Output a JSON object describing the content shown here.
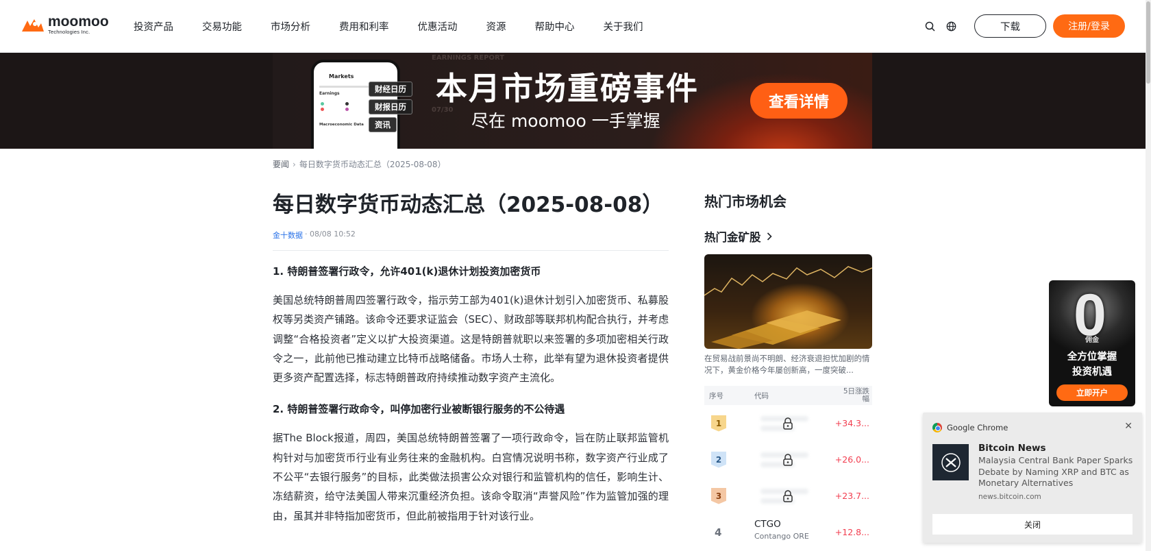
{
  "header": {
    "logo_name": "moomoo",
    "logo_sub": "Technologies Inc.",
    "nav": [
      "投资产品",
      "交易功能",
      "市场分析",
      "费用和利率",
      "优惠活动",
      "资源",
      "帮助中心",
      "关于我们"
    ],
    "download_label": "下载",
    "register_label": "注册/登录",
    "brand_color": "#ff6a13"
  },
  "banner": {
    "phone_title": "Markets",
    "phone_section": "Earnings",
    "phone_section2": "Macroeconomic Data",
    "bg_text_1": "EARNINGS REPORT",
    "bg_text_2": "07/30",
    "tags": [
      "财经日历",
      "财报日历",
      "资讯"
    ],
    "headline": "本月市场重磅事件",
    "subline": "尽在 moomoo 一手掌握",
    "cta": "查看详情"
  },
  "breadcrumb": {
    "root": "要闻",
    "current": "每日数字货币动态汇总（2025-08-08）"
  },
  "article": {
    "title": "每日数字货币动态汇总（2025-08-08）",
    "source": "金十数据",
    "time": "· 08/08 10:52",
    "sections": [
      {
        "heading": "1. 特朗普签署行政令，允许401(k)退休计划投资加密货币",
        "body": "美国总统特朗普周四签署行政令，指示劳工部为401(k)退休计划引入加密货币、私募股权等另类资产铺路。该命令还要求证监会（SEC）、财政部等联邦机构配合执行，并考虑调整“合格投资者”定义以扩大投资渠道。这是特朗普就职以来签署的多项加密相关行政令之一，此前他已推动建立比特币战略储备。市场人士称，此举有望为退休投资者提供更多资产配置选择，标志特朗普政府持续推动数字资产主流化。"
      },
      {
        "heading": "2. 特朗普签署行政命令，叫停加密行业被断银行服务的不公待遇",
        "body": "据The Block报道，周四，美国总统特朗普签署了一项行政命令，旨在防止联邦监管机构针对与加密货币行业有业务往来的金融机构。白宫情况说明书称，数字资产行业成了不公平“去银行服务”的目标，此类做法损害公众对银行和监管机构的信任，影响生计、冻结薪资，给守法美国人带来沉重经济负担。该命令取消“声誉风险”作为监管加强的理由，虽其并非特指加密货币，但此前被指用于针对该行业。"
      }
    ]
  },
  "sidebar": {
    "title": "热门市场机会",
    "subtitle": "热门金矿股",
    "desc": "在贸易战前景尚不明朗、经济衰退担忧加剧的情况下，黄金价格今年屡创新高，一度突破...",
    "table_headers": [
      "序号",
      "代码",
      "5日涨跌幅"
    ],
    "rows": [
      {
        "rank": "1",
        "change": "+34.3...",
        "locked": true
      },
      {
        "rank": "2",
        "change": "+26.0...",
        "locked": true
      },
      {
        "rank": "3",
        "change": "+23.7...",
        "locked": true
      },
      {
        "rank": "4",
        "code": "CTGO",
        "name": "Contango ORE",
        "change": "+12.8...",
        "locked": false
      }
    ]
  },
  "promo": {
    "zero": "0",
    "label_small": "佣金",
    "line1": "全方位掌握",
    "line2": "投资机遇",
    "button": "立即开户"
  },
  "notification": {
    "app": "Google Chrome",
    "title": "Bitcoin News",
    "body": "Malaysia Central Bank Paper Sparks Debate by Naming XRP and BTC as Monetary Alternatives",
    "site": "news.bitcoin.com",
    "button": "关闭"
  }
}
